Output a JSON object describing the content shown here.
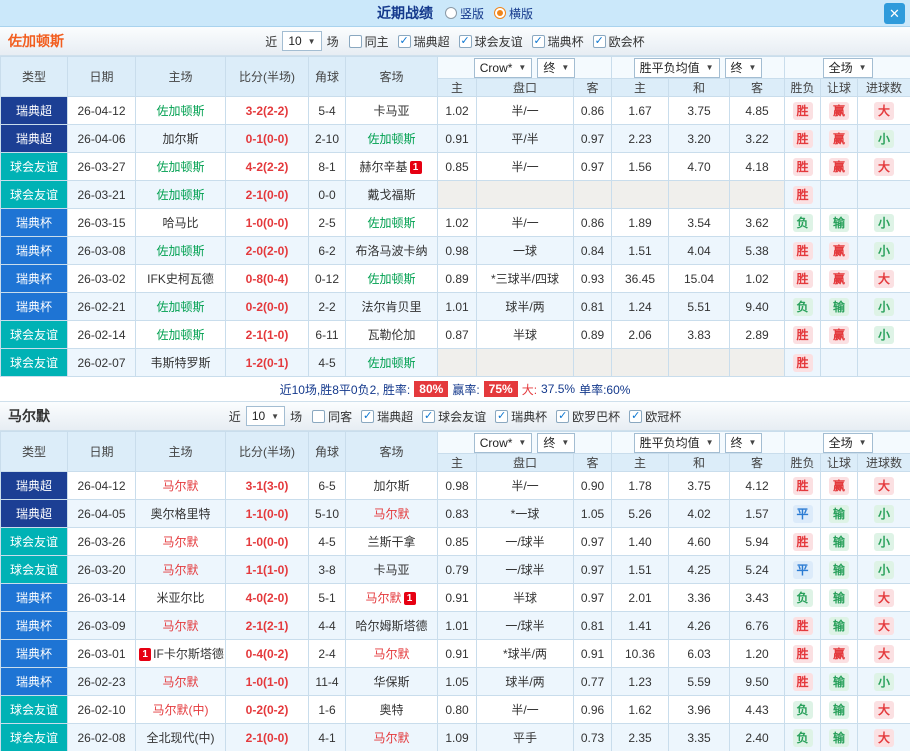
{
  "titlebar": {
    "title": "近期战绩",
    "radios": [
      {
        "label": "竖版",
        "selected": false
      },
      {
        "label": "横版",
        "selected": true
      }
    ],
    "close": "✕"
  },
  "league_colors": {
    "瑞典超": "#1c3f94",
    "球会友谊": "#00b2b5",
    "瑞典杯": "#1e74d4"
  },
  "table_header": {
    "main_cols": [
      "类型",
      "日期",
      "主场",
      "比分(半场)",
      "角球",
      "客场"
    ],
    "odds_select": "Crow*",
    "odds_final_select": "终",
    "mean_select": "胜平负均值",
    "mean_final_select": "终",
    "scope_select": "全场",
    "sub_cols": [
      "主",
      "盘口",
      "客",
      "主",
      "和",
      "客",
      "胜负",
      "让球",
      "进球数"
    ]
  },
  "sections": [
    {
      "team": "佐加顿斯",
      "team_color": "#f25d1e",
      "focus_color": "#00a050",
      "filters": {
        "prefix": "近",
        "count": "10",
        "suffix": "场",
        "checkboxes": [
          {
            "label": "同主",
            "checked": false
          },
          {
            "label": "瑞典超",
            "checked": true
          },
          {
            "label": "球会友谊",
            "checked": true
          },
          {
            "label": "瑞典杯",
            "checked": true
          },
          {
            "label": "欧会杯",
            "checked": true
          }
        ]
      },
      "rows": [
        {
          "league": "瑞典超",
          "date": "26-04-12",
          "home": "佐加顿斯",
          "hf": true,
          "score": "3-2(2-2)",
          "corner": "5-4",
          "away": "卡马亚",
          "af": false,
          "o1": "1.02",
          "hcp": "半/一",
          "o2": "0.86",
          "m1": "1.67",
          "m2": "3.75",
          "m3": "4.85",
          "r1": "胜",
          "k1": "w",
          "r2": "赢",
          "k2": "w",
          "r3": "大",
          "k3": "w"
        },
        {
          "league": "瑞典超",
          "date": "26-04-06",
          "home": "加尔斯",
          "hf": false,
          "score": "0-1(0-0)",
          "corner": "2-10",
          "away": "佐加顿斯",
          "af": true,
          "o1": "0.91",
          "hcp": "平/半",
          "o2": "0.97",
          "m1": "2.23",
          "m2": "3.20",
          "m3": "3.22",
          "r1": "胜",
          "k1": "w",
          "r2": "赢",
          "k2": "w",
          "r3": "小",
          "k3": "l"
        },
        {
          "league": "球会友谊",
          "date": "26-03-27",
          "home": "佐加顿斯",
          "hf": true,
          "score": "4-2(2-2)",
          "corner": "8-1",
          "away": "赫尔辛基",
          "af": false,
          "away_card": "1",
          "o1": "0.85",
          "hcp": "半/一",
          "o2": "0.97",
          "m1": "1.56",
          "m2": "4.70",
          "m3": "4.18",
          "r1": "胜",
          "k1": "w",
          "r2": "赢",
          "k2": "w",
          "r3": "大",
          "k3": "w"
        },
        {
          "league": "球会友谊",
          "date": "26-03-21",
          "home": "佐加顿斯",
          "hf": true,
          "score": "2-1(0-0)",
          "corner": "0-0",
          "away": "戴戈福斯",
          "af": false,
          "noodds": true,
          "o1": "",
          "hcp": "",
          "o2": "",
          "m1": "",
          "m2": "",
          "m3": "",
          "r1": "胜",
          "k1": "w",
          "r2": "",
          "k2": "",
          "r3": "",
          "k3": ""
        },
        {
          "league": "瑞典杯",
          "date": "26-03-15",
          "home": "哈马比",
          "hf": false,
          "score": "1-0(0-0)",
          "corner": "2-5",
          "away": "佐加顿斯",
          "af": true,
          "o1": "1.02",
          "hcp": "半/一",
          "o2": "0.86",
          "m1": "1.89",
          "m2": "3.54",
          "m3": "3.62",
          "r1": "负",
          "k1": "l",
          "r2": "输",
          "k2": "l",
          "r3": "小",
          "k3": "l"
        },
        {
          "league": "瑞典杯",
          "date": "26-03-08",
          "home": "佐加顿斯",
          "hf": true,
          "score": "2-0(2-0)",
          "corner": "6-2",
          "away": "布洛马波卡纳",
          "af": false,
          "o1": "0.98",
          "hcp": "一球",
          "o2": "0.84",
          "m1": "1.51",
          "m2": "4.04",
          "m3": "5.38",
          "r1": "胜",
          "k1": "w",
          "r2": "赢",
          "k2": "w",
          "r3": "小",
          "k3": "l"
        },
        {
          "league": "瑞典杯",
          "date": "26-03-02",
          "home": "IFK史柯瓦德",
          "hf": false,
          "score": "0-8(0-4)",
          "corner": "0-12",
          "away": "佐加顿斯",
          "af": true,
          "o1": "0.89",
          "hcp": "*三球半/四球",
          "o2": "0.93",
          "m1": "36.45",
          "m2": "15.04",
          "m3": "1.02",
          "r1": "胜",
          "k1": "w",
          "r2": "赢",
          "k2": "w",
          "r3": "大",
          "k3": "w"
        },
        {
          "league": "瑞典杯",
          "date": "26-02-21",
          "home": "佐加顿斯",
          "hf": true,
          "score": "0-2(0-0)",
          "corner": "2-2",
          "away": "法尔肯贝里",
          "af": false,
          "o1": "1.01",
          "hcp": "球半/两",
          "o2": "0.81",
          "m1": "1.24",
          "m2": "5.51",
          "m3": "9.40",
          "r1": "负",
          "k1": "l",
          "r2": "输",
          "k2": "l",
          "r3": "小",
          "k3": "l"
        },
        {
          "league": "球会友谊",
          "date": "26-02-14",
          "home": "佐加顿斯",
          "hf": true,
          "score": "2-1(1-0)",
          "corner": "6-11",
          "away": "瓦勒伦加",
          "af": false,
          "o1": "0.87",
          "hcp": "半球",
          "o2": "0.89",
          "m1": "2.06",
          "m2": "3.83",
          "m3": "2.89",
          "r1": "胜",
          "k1": "w",
          "r2": "赢",
          "k2": "w",
          "r3": "小",
          "k3": "l"
        },
        {
          "league": "球会友谊",
          "date": "26-02-07",
          "home": "韦斯特罗斯",
          "hf": false,
          "score": "1-2(0-1)",
          "corner": "4-5",
          "away": "佐加顿斯",
          "af": true,
          "noodds": true,
          "o1": "",
          "hcp": "",
          "o2": "",
          "m1": "",
          "m2": "",
          "m3": "",
          "r1": "胜",
          "k1": "w",
          "r2": "",
          "k2": "",
          "r3": "",
          "k3": ""
        }
      ],
      "summary": [
        {
          "text": "近10场,胜8平0负2, 胜率:",
          "cls": "navy"
        },
        {
          "text": "80%",
          "cls": "redbox"
        },
        {
          "text": "赢率:",
          "cls": "navy"
        },
        {
          "text": "75%",
          "cls": "redbox"
        },
        {
          "text": "大:",
          "cls": "red"
        },
        {
          "text": "37.5%",
          "cls": "navy"
        },
        {
          "text": "单率:60%",
          "cls": "navy"
        }
      ]
    },
    {
      "team": "马尔默",
      "team_color": "#333333",
      "focus_color": "#e4393c",
      "filters": {
        "prefix": "近",
        "count": "10",
        "suffix": "场",
        "checkboxes": [
          {
            "label": "同客",
            "checked": false
          },
          {
            "label": "瑞典超",
            "checked": true
          },
          {
            "label": "球会友谊",
            "checked": true
          },
          {
            "label": "瑞典杯",
            "checked": true
          },
          {
            "label": "欧罗巴杯",
            "checked": true
          },
          {
            "label": "欧冠杯",
            "checked": true
          }
        ]
      },
      "rows": [
        {
          "league": "瑞典超",
          "date": "26-04-12",
          "home": "马尔默",
          "hf": true,
          "score": "3-1(3-0)",
          "corner": "6-5",
          "away": "加尔斯",
          "af": false,
          "o1": "0.98",
          "hcp": "半/一",
          "o2": "0.90",
          "m1": "1.78",
          "m2": "3.75",
          "m3": "4.12",
          "r1": "胜",
          "k1": "w",
          "r2": "赢",
          "k2": "w",
          "r3": "大",
          "k3": "w"
        },
        {
          "league": "瑞典超",
          "date": "26-04-05",
          "home": "奥尔格里特",
          "hf": false,
          "score": "1-1(0-0)",
          "corner": "5-10",
          "away": "马尔默",
          "af": true,
          "o1": "0.83",
          "hcp": "*一球",
          "o2": "1.05",
          "m1": "5.26",
          "m2": "4.02",
          "m3": "1.57",
          "r1": "平",
          "k1": "d",
          "r2": "输",
          "k2": "l",
          "r3": "小",
          "k3": "l"
        },
        {
          "league": "球会友谊",
          "date": "26-03-26",
          "home": "马尔默",
          "hf": true,
          "score": "1-0(0-0)",
          "corner": "4-5",
          "away": "兰斯干拿",
          "af": false,
          "o1": "0.85",
          "hcp": "一/球半",
          "o2": "0.97",
          "m1": "1.40",
          "m2": "4.60",
          "m3": "5.94",
          "r1": "胜",
          "k1": "w",
          "r2": "输",
          "k2": "l",
          "r3": "小",
          "k3": "l"
        },
        {
          "league": "球会友谊",
          "date": "26-03-20",
          "home": "马尔默",
          "hf": true,
          "score": "1-1(1-0)",
          "corner": "3-8",
          "away": "卡马亚",
          "af": false,
          "o1": "0.79",
          "hcp": "一/球半",
          "o2": "0.97",
          "m1": "1.51",
          "m2": "4.25",
          "m3": "5.24",
          "r1": "平",
          "k1": "d",
          "r2": "输",
          "k2": "l",
          "r3": "小",
          "k3": "l"
        },
        {
          "league": "瑞典杯",
          "date": "26-03-14",
          "home": "米亚尔比",
          "hf": false,
          "score": "4-0(2-0)",
          "corner": "5-1",
          "away": "马尔默",
          "af": true,
          "away_card": "1",
          "o1": "0.91",
          "hcp": "半球",
          "o2": "0.97",
          "m1": "2.01",
          "m2": "3.36",
          "m3": "3.43",
          "r1": "负",
          "k1": "l",
          "r2": "输",
          "k2": "l",
          "r3": "大",
          "k3": "w"
        },
        {
          "league": "瑞典杯",
          "date": "26-03-09",
          "home": "马尔默",
          "hf": true,
          "score": "2-1(2-1)",
          "corner": "4-4",
          "away": "哈尔姆斯塔德",
          "af": false,
          "o1": "1.01",
          "hcp": "一/球半",
          "o2": "0.81",
          "m1": "1.41",
          "m2": "4.26",
          "m3": "6.76",
          "r1": "胜",
          "k1": "w",
          "r2": "输",
          "k2": "l",
          "r3": "大",
          "k3": "w"
        },
        {
          "league": "瑞典杯",
          "date": "26-03-01",
          "home": "IF卡尔斯塔德",
          "hf": false,
          "home_card": "1",
          "home_card_pos": "pre",
          "score": "0-4(0-2)",
          "corner": "2-4",
          "away": "马尔默",
          "af": true,
          "o1": "0.91",
          "hcp": "*球半/两",
          "o2": "0.91",
          "m1": "10.36",
          "m2": "6.03",
          "m3": "1.20",
          "r1": "胜",
          "k1": "w",
          "r2": "赢",
          "k2": "w",
          "r3": "大",
          "k3": "w"
        },
        {
          "league": "瑞典杯",
          "date": "26-02-23",
          "home": "马尔默",
          "hf": true,
          "score": "1-0(1-0)",
          "corner": "11-4",
          "away": "华保斯",
          "af": false,
          "o1": "1.05",
          "hcp": "球半/两",
          "o2": "0.77",
          "m1": "1.23",
          "m2": "5.59",
          "m3": "9.50",
          "r1": "胜",
          "k1": "w",
          "r2": "输",
          "k2": "l",
          "r3": "小",
          "k3": "l"
        },
        {
          "league": "球会友谊",
          "date": "26-02-10",
          "home": "马尔默(中)",
          "hf": true,
          "score": "0-2(0-2)",
          "corner": "1-6",
          "away": "奥特",
          "af": false,
          "o1": "0.80",
          "hcp": "半/一",
          "o2": "0.96",
          "m1": "1.62",
          "m2": "3.96",
          "m3": "4.43",
          "r1": "负",
          "k1": "l",
          "r2": "输",
          "k2": "l",
          "r3": "大",
          "k3": "w"
        },
        {
          "league": "球会友谊",
          "date": "26-02-08",
          "home": "全北现代(中)",
          "hf": false,
          "score": "2-1(0-0)",
          "corner": "4-1",
          "away": "马尔默",
          "af": true,
          "o1": "1.09",
          "hcp": "平手",
          "o2": "0.73",
          "m1": "2.35",
          "m2": "3.35",
          "m3": "2.40",
          "r1": "负",
          "k1": "l",
          "r2": "输",
          "k2": "l",
          "r3": "大",
          "k3": "w"
        }
      ],
      "summary": []
    }
  ]
}
